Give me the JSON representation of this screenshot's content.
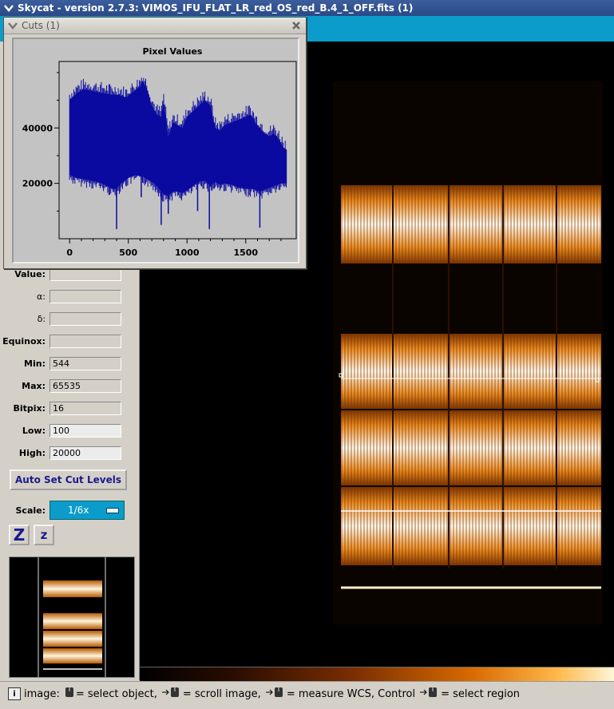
{
  "window": {
    "title": "Skycat - version 2.7.3: VIMOS_IFU_FLAT_LR_red_OS_red_B.4_1_OFF.fits (1)"
  },
  "cuts_dialog": {
    "title": "Cuts (1)"
  },
  "chart_data": {
    "type": "line",
    "title": "Pixel Values",
    "xlabel": "",
    "ylabel": "",
    "xlim": [
      -90,
      1930
    ],
    "ylim": [
      0,
      64000
    ],
    "xticks": [
      0,
      500,
      1000,
      1500
    ],
    "yticks": [
      20000,
      40000
    ],
    "series_color": "#0a0aa0",
    "series": [
      {
        "upper": [
          [
            0,
            50000
          ],
          [
            60,
            52500
          ],
          [
            120,
            54000
          ],
          [
            180,
            53500
          ],
          [
            240,
            53000
          ],
          [
            300,
            52500
          ],
          [
            360,
            52000
          ],
          [
            420,
            52000
          ],
          [
            480,
            51000
          ],
          [
            540,
            53000
          ],
          [
            600,
            55000
          ],
          [
            620,
            57000
          ],
          [
            660,
            54000
          ],
          [
            700,
            48000
          ],
          [
            740,
            45000
          ],
          [
            780,
            44000
          ],
          [
            800,
            50000
          ],
          [
            840,
            37000
          ],
          [
            880,
            42000
          ],
          [
            920,
            41000
          ],
          [
            960,
            40000
          ],
          [
            1000,
            44000
          ],
          [
            1050,
            46000
          ],
          [
            1100,
            48000
          ],
          [
            1150,
            50000
          ],
          [
            1200,
            48000
          ],
          [
            1240,
            40000
          ],
          [
            1280,
            39000
          ],
          [
            1320,
            41000
          ],
          [
            1380,
            42000
          ],
          [
            1440,
            43000
          ],
          [
            1500,
            44000
          ],
          [
            1540,
            45000
          ],
          [
            1580,
            42000
          ],
          [
            1620,
            40000
          ],
          [
            1660,
            38000
          ],
          [
            1700,
            37000
          ],
          [
            1740,
            38000
          ],
          [
            1780,
            36000
          ],
          [
            1820,
            33000
          ],
          [
            1850,
            32000
          ]
        ],
        "lower": [
          [
            0,
            23000
          ],
          [
            60,
            22000
          ],
          [
            120,
            21500
          ],
          [
            180,
            21000
          ],
          [
            240,
            20500
          ],
          [
            300,
            19500
          ],
          [
            360,
            18000
          ],
          [
            400,
            18000
          ],
          [
            440,
            20000
          ],
          [
            500,
            22000
          ],
          [
            560,
            23000
          ],
          [
            620,
            22500
          ],
          [
            680,
            21000
          ],
          [
            720,
            20000
          ],
          [
            760,
            18000
          ],
          [
            800,
            16000
          ],
          [
            840,
            15500
          ],
          [
            880,
            17000
          ],
          [
            920,
            17000
          ],
          [
            960,
            16500
          ],
          [
            1000,
            17500
          ],
          [
            1050,
            19000
          ],
          [
            1100,
            20500
          ],
          [
            1150,
            21000
          ],
          [
            1200,
            19000
          ],
          [
            1240,
            20500
          ],
          [
            1280,
            19500
          ],
          [
            1320,
            20000
          ],
          [
            1380,
            19500
          ],
          [
            1440,
            18500
          ],
          [
            1500,
            18000
          ],
          [
            1560,
            18000
          ],
          [
            1620,
            17000
          ],
          [
            1680,
            18000
          ],
          [
            1740,
            19000
          ],
          [
            1800,
            20000
          ],
          [
            1850,
            20000
          ]
        ],
        "dips": [
          [
            400,
            3500
          ],
          [
            780,
            5000
          ],
          [
            840,
            9000
          ],
          [
            1190,
            3500
          ],
          [
            1620,
            4000
          ],
          [
            1090,
            10000
          ],
          [
            610,
            15000
          ]
        ]
      }
    ]
  },
  "panel": {
    "fields": [
      {
        "label": "Value:",
        "value": ""
      },
      {
        "label": "α:",
        "value": ""
      },
      {
        "label": "δ:",
        "value": ""
      },
      {
        "label": "Equinox:",
        "value": ""
      },
      {
        "label": "Min:",
        "value": "544"
      },
      {
        "label": "Max:",
        "value": "65535"
      },
      {
        "label": "Bitpix:",
        "value": "16"
      },
      {
        "label": "Low:",
        "value": "100"
      },
      {
        "label": "High:",
        "value": "20000"
      }
    ],
    "auto_set_label": "Auto Set Cut Levels",
    "scale_label": "Scale:",
    "scale_value": "1/6x",
    "zoom_in_label": "Z",
    "zoom_out_label": "z"
  },
  "status": {
    "prefix": "image:",
    "seg1": "= select object,",
    "seg2": "= scroll image,",
    "seg3": "= measure WCS, Control",
    "seg4": "= select region"
  }
}
